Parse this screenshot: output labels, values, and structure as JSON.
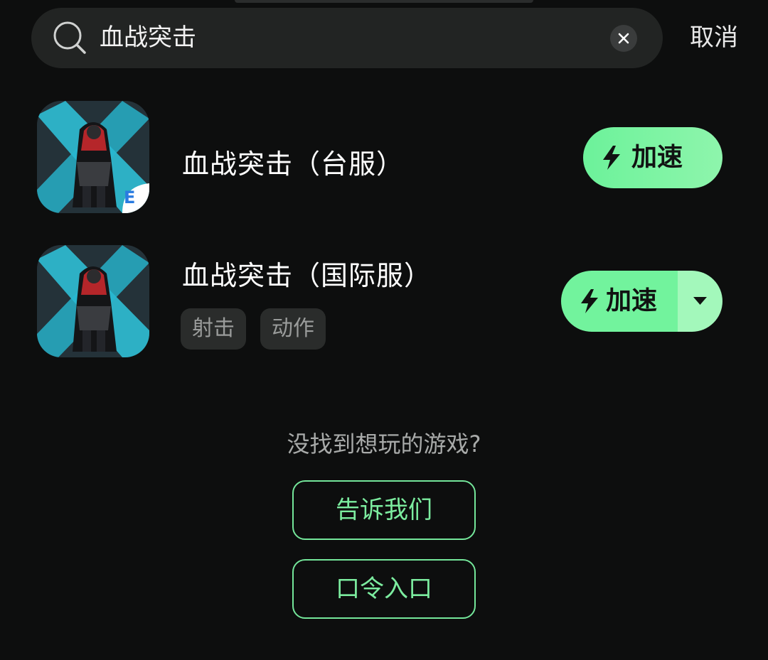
{
  "search": {
    "query": "血战突击",
    "cancel_label": "取消",
    "icon": "search-icon",
    "clear_icon": "close-icon"
  },
  "results": [
    {
      "title": "血战突击（台服）",
      "tags": [],
      "button_label": "加速",
      "has_dropdown": false,
      "badge": "E"
    },
    {
      "title": "血战突击（国际服）",
      "tags": [
        "射击",
        "动作"
      ],
      "button_label": "加速",
      "has_dropdown": true
    }
  ],
  "footer": {
    "prompt": "没找到想玩的游戏?",
    "tell_us_label": "告诉我们",
    "code_entry_label": "口令入口"
  },
  "colors": {
    "accent": "#72f39d",
    "background": "#0d0e0e",
    "search_bg": "#222423"
  }
}
